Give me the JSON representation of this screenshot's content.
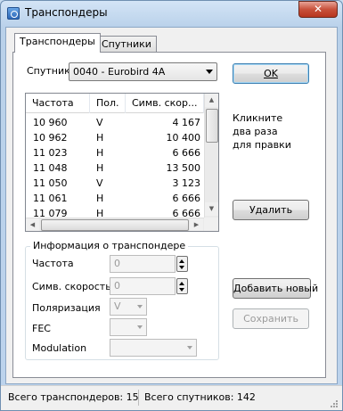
{
  "window": {
    "title": "Транспондеры",
    "close_glyph": "✕"
  },
  "tabs": [
    {
      "label": "Транспондеры",
      "active": true
    },
    {
      "label": "Спутники",
      "active": false
    }
  ],
  "satellite": {
    "label": "Спутник",
    "value": "0040 - Eurobird 4A"
  },
  "transponders": {
    "columns": [
      "Частота",
      "Пол.",
      "Симв. скор..."
    ],
    "rows": [
      [
        "10 960",
        "V",
        "4 167"
      ],
      [
        "10 962",
        "H",
        "10 400"
      ],
      [
        "11 023",
        "H",
        "6 666"
      ],
      [
        "11 048",
        "H",
        "13 500"
      ],
      [
        "11 050",
        "V",
        "3 123"
      ],
      [
        "11 061",
        "H",
        "6 666"
      ],
      [
        "11 079",
        "H",
        "6 666"
      ]
    ]
  },
  "buttons": {
    "ok": "OK",
    "delete": "Удалить",
    "add_new": "Добавить новый",
    "save": "Сохранить"
  },
  "hint": {
    "line1": "Кликните",
    "line2": "два раза",
    "line3": "для правки"
  },
  "info": {
    "title": "Информация о транспондере",
    "frequency_label": "Частота",
    "frequency_value": "0",
    "symbol_rate_label": "Симв. скорость",
    "symbol_rate_value": "0",
    "polarization_label": "Поляризация",
    "polarization_value": "V",
    "fec_label": "FEC",
    "fec_value": "",
    "modulation_label": "Modulation",
    "modulation_value": ""
  },
  "status": {
    "transponders": "Всего транспондеров: 15",
    "satellites": "Всего спутников: 142"
  },
  "icons": [
    "app-icon",
    "close-icon",
    "dropdown-arrow-icon",
    "spin-up-icon",
    "spin-down-icon",
    "size-grip-icon"
  ]
}
